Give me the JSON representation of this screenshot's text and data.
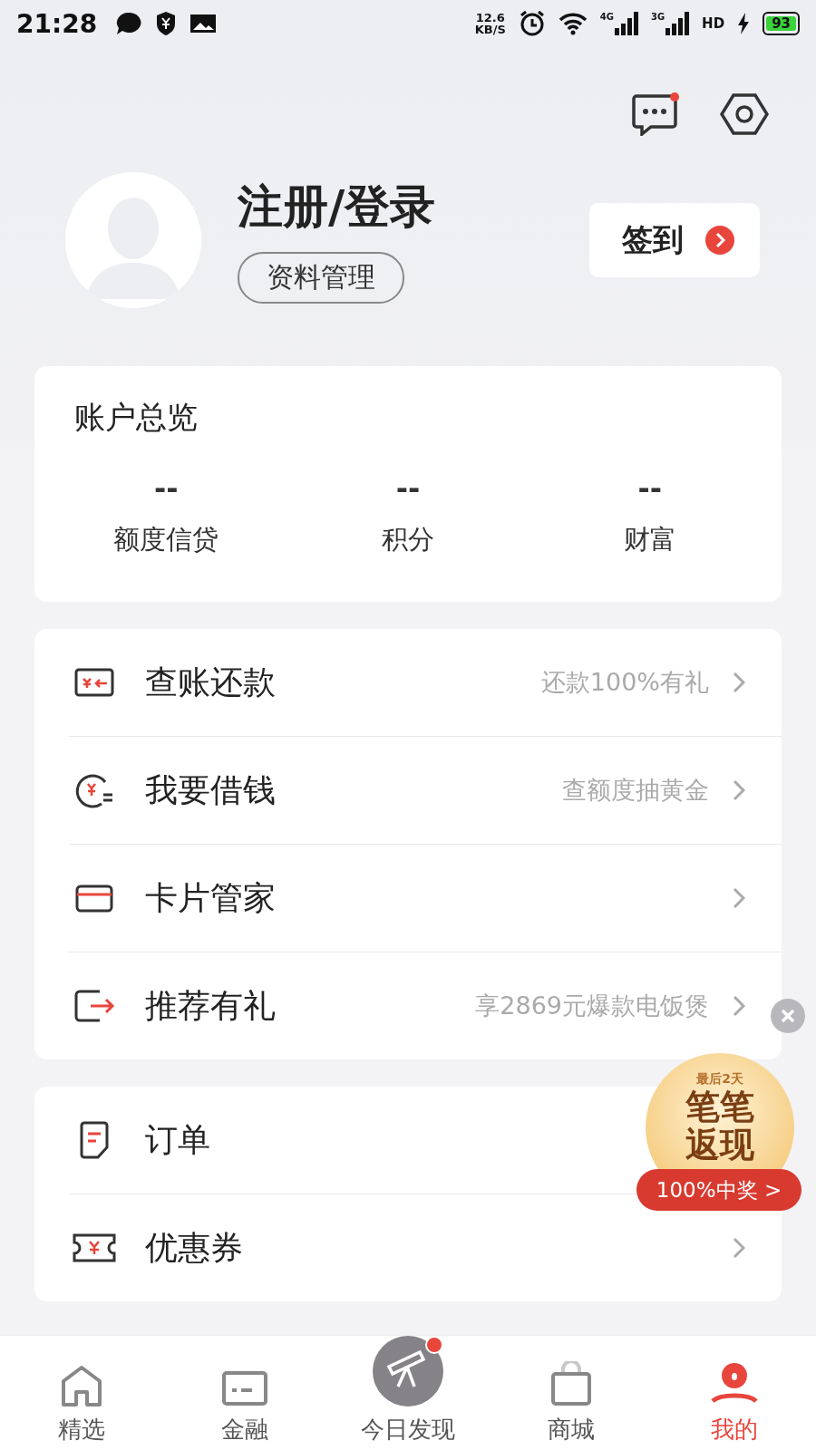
{
  "status_bar": {
    "time": "21:28",
    "net_speed": "12.6",
    "net_unit": "KB/S",
    "network_1": "4G",
    "network_2": "3G",
    "hd": "HD",
    "battery": "93",
    "charging": true
  },
  "header": {
    "message_unread": true,
    "title": "注册/登录",
    "profile_button": "资料管理",
    "checkin_button": "签到"
  },
  "overview": {
    "title": "账户总览",
    "stats": [
      {
        "value": "--",
        "label": "额度信贷"
      },
      {
        "value": "--",
        "label": "积分"
      },
      {
        "value": "--",
        "label": "财富"
      }
    ]
  },
  "menu_groups": [
    {
      "items": [
        {
          "kind": "bill",
          "label": "查账还款",
          "hint": "还款100%有礼"
        },
        {
          "kind": "loan",
          "label": "我要借钱",
          "hint": "查额度抽黄金"
        },
        {
          "kind": "card",
          "label": "卡片管家"
        },
        {
          "kind": "share",
          "label": "推荐有礼",
          "hint": "享2869元爆款电饭煲"
        }
      ]
    },
    {
      "items": [
        {
          "kind": "order",
          "label": "订单"
        },
        {
          "kind": "coupon",
          "label": "优惠券"
        }
      ]
    }
  ],
  "promo": {
    "tag": "最后2天",
    "title_1": "笔笔",
    "title_2": "返现",
    "button": "100%中奖 >"
  },
  "bottom_nav": [
    {
      "kind": "home",
      "label": "精选",
      "selected": false,
      "badge": false
    },
    {
      "kind": "finance",
      "label": "金融",
      "selected": false,
      "badge": false
    },
    {
      "kind": "telescope",
      "label": "今日发现",
      "selected": false,
      "badge": true
    },
    {
      "kind": "bag",
      "label": "商城",
      "selected": false,
      "badge": false
    },
    {
      "kind": "person",
      "label": "我的",
      "selected": true,
      "badge": false
    }
  ]
}
